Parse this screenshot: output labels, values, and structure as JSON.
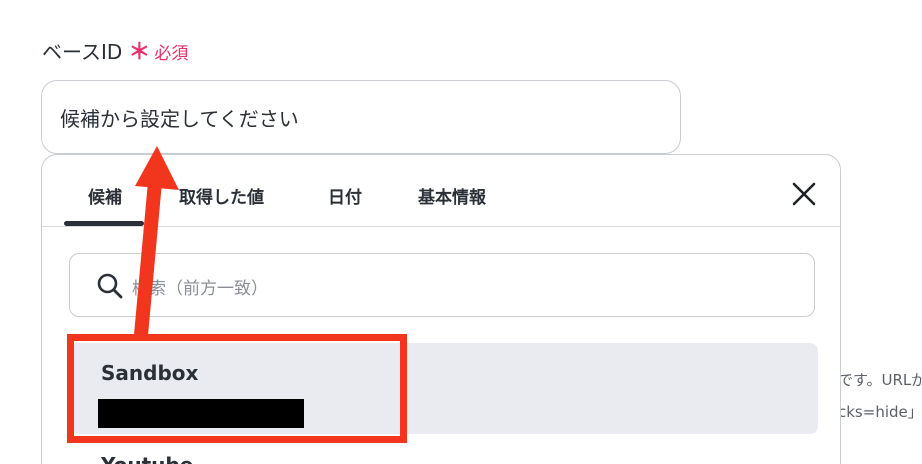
{
  "field": {
    "label": "ベースID",
    "required_mark": "＊",
    "required_text": "必須",
    "placeholder": "候補から設定してください"
  },
  "dropdown": {
    "tabs": [
      {
        "label": "候補",
        "active": true
      },
      {
        "label": "取得した値",
        "active": false
      },
      {
        "label": "日付",
        "active": false
      },
      {
        "label": "基本情報",
        "active": false
      }
    ],
    "search_placeholder": "検索（前方一致）",
    "options": [
      {
        "name": "Sandbox",
        "id_redacted": true,
        "hovered": true
      },
      {
        "name": "Youtube",
        "id_redacted": false,
        "hovered": false
      }
    ]
  },
  "background_text": {
    "hint_line1": "です。URLが",
    "hint_line2": "cks=hide」"
  },
  "annotation": {
    "color": "#f2361d"
  },
  "colors": {
    "required": "#e8306a",
    "text": "#2b2f36",
    "option_hover_bg": "#e9ebf0",
    "border": "#c9ccd1"
  }
}
